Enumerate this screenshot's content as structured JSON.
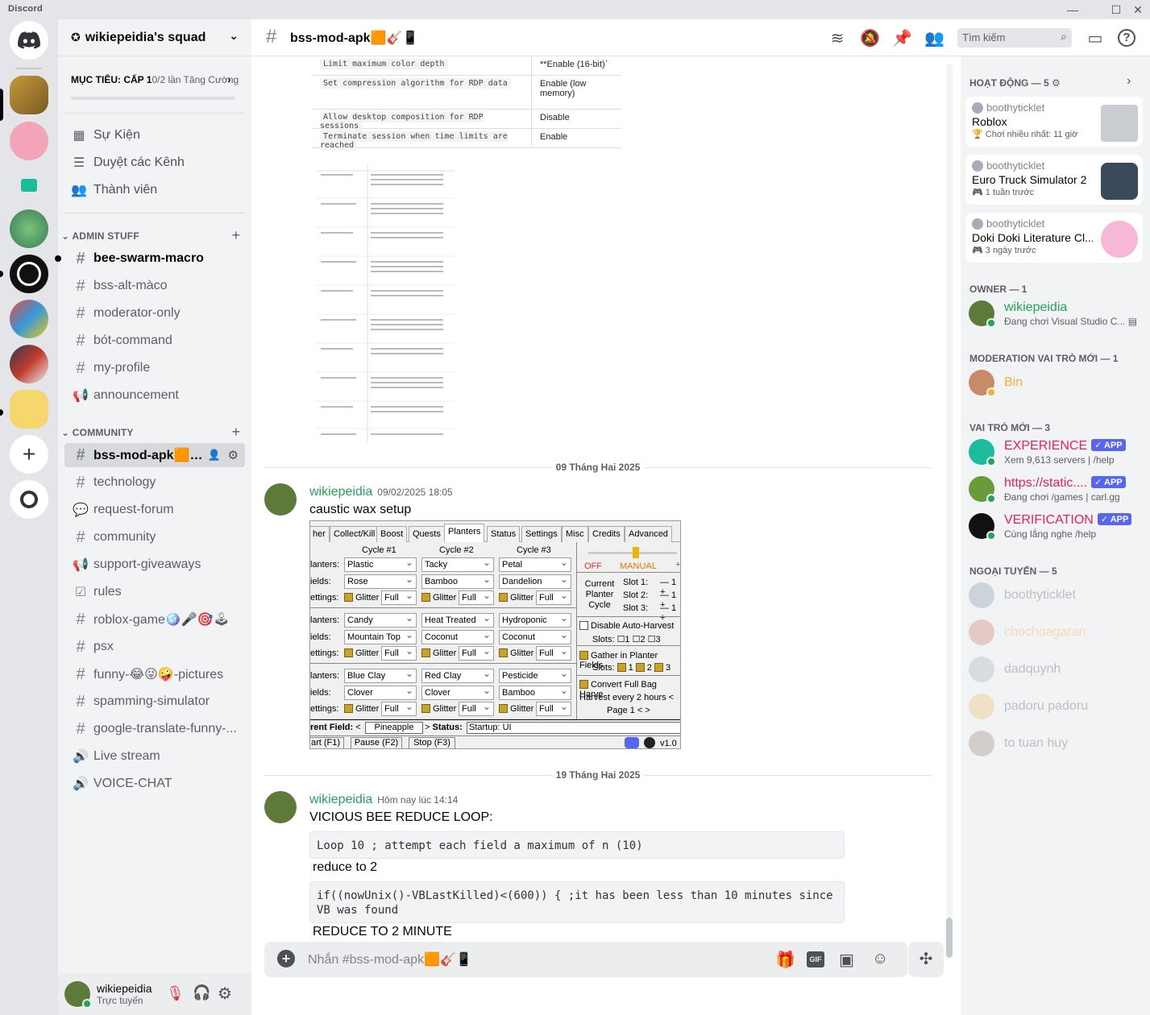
{
  "app": {
    "title": "Discord"
  },
  "server": {
    "name": "wikiepeidia's squad",
    "goal_prefix": "MỤC TIÊU: CẤP 1",
    "goal_suffix": "0/2 lần Tăng Cường",
    "nav": [
      {
        "label": "Sự Kiện",
        "icon": "calendar-icon"
      },
      {
        "label": "Duyệt các Kênh",
        "icon": "browse-channels-icon"
      },
      {
        "label": "Thành viên",
        "icon": "members-icon"
      }
    ],
    "categories": [
      {
        "name": "ADMIN STUFF",
        "channels": [
          {
            "name": "bee-swarm-macro",
            "type": "text",
            "unread": true
          },
          {
            "name": "bss-alt-màco",
            "type": "text"
          },
          {
            "name": "moderator-only",
            "type": "text"
          },
          {
            "name": "bót-command",
            "type": "text"
          },
          {
            "name": "my-profile",
            "type": "text"
          },
          {
            "name": "announcement",
            "type": "announcement"
          }
        ]
      },
      {
        "name": "COMMUNITY",
        "channels": [
          {
            "name": "bss-mod-apk🟧…",
            "type": "text",
            "selected": true
          },
          {
            "name": "technology",
            "type": "text"
          },
          {
            "name": "request-forum",
            "type": "forum"
          },
          {
            "name": "community",
            "type": "text"
          },
          {
            "name": "support-giveaways",
            "type": "announcement"
          },
          {
            "name": "rules",
            "type": "rules"
          },
          {
            "name": "roblox-game🪩🎤🎯🕹",
            "type": "text"
          },
          {
            "name": "psx",
            "type": "text"
          },
          {
            "name": "funny-😂😜🤪-pictures",
            "type": "text"
          },
          {
            "name": "spamming-simulator",
            "type": "text"
          },
          {
            "name": "google-translate-funny-...",
            "type": "text"
          },
          {
            "name": "Live stream",
            "type": "voice"
          },
          {
            "name": "VOICE-CHAT",
            "type": "voice"
          }
        ]
      }
    ]
  },
  "user": {
    "name": "wikiepeidia",
    "status": "Trực tuyến"
  },
  "channel": {
    "name": "bss-mod-apk🟧🎸📱",
    "search_placeholder": "Tìm kiếm",
    "composer_placeholder": "Nhắn #bss-mod-apk🟧🎸📱"
  },
  "rdp_table": [
    {
      "key": "Limit maximum color depth",
      "value": "**Enable (16-bit)`"
    },
    {
      "key": "Set compression algorithm for RDP data",
      "value": "Enable (low memory)"
    },
    {
      "key": "Allow desktop composition for RDP sessions",
      "value": "Disable"
    },
    {
      "key": "Terminate session when time limits are reached",
      "value": "Enable"
    }
  ],
  "dividers": [
    "09 Tháng Hai 2025",
    "19 Tháng Hai 2025"
  ],
  "messages": [
    {
      "author": "wikiepeidia",
      "time": "09/02/2025 18:05",
      "text": "caustic wax setup"
    },
    {
      "author": "wikiepeidia",
      "time": "Hôm nay lúc 14:14",
      "text": "VICIOUS BEE REDUCE LOOP:",
      "code1": "Loop 10 ; attempt each field a maximum of n (10)",
      "text2": "reduce to 2",
      "code2": "if((nowUnix()-VBLastKilled)<(600)) { ;it has been less than 10 minutes since VB was found",
      "text3": "REDUCE TO 2 MINUTE"
    }
  ],
  "macro": {
    "tabs": [
      "her",
      "Collect/Kill",
      "Boost",
      "Quests",
      "Planters",
      "Status",
      "Settings",
      "Misc",
      "Credits",
      "Advanced"
    ],
    "cycles": [
      "Cycle #1",
      "Cycle #2",
      "Cycle #3"
    ],
    "row_labels": [
      "lanters:",
      "ields:",
      "ettings:"
    ],
    "blocks": [
      {
        "planters": [
          "Plastic",
          "Tacky",
          "Petal"
        ],
        "fields": [
          "Rose",
          "Bamboo",
          "Dandelion"
        ]
      },
      {
        "planters": [
          "Candy",
          "Heat Treated",
          "Hydroponic"
        ],
        "fields": [
          "Mountain Top",
          "Coconut",
          "Coconut"
        ]
      },
      {
        "planters": [
          "Blue Clay",
          "Red Clay",
          "Pesticide"
        ],
        "fields": [
          "Clover",
          "Clover",
          "Bamboo"
        ]
      }
    ],
    "glitter": "Glitter",
    "full": "Full",
    "off": "OFF",
    "manual": "MANUAL",
    "current_planter_cycle": "Current Planter Cycle",
    "slots": [
      "Slot 1:",
      "Slot 2:",
      "Slot 3:"
    ],
    "disable_auto_harvest": "Disable Auto-Harvest",
    "slots_label": "Slots:",
    "gather_in_planter_fields": "Gather in Planter Fields",
    "convert_full_bag": "Convert Full Bag Harve",
    "harvest_every": "Harvest every 2 hours",
    "page": "Page 1",
    "current_field": "rent Field:",
    "field_value": "Pineapple",
    "status_label": "Status:",
    "status_value": "Startup: UI",
    "buttons": [
      "art (F1)",
      "Pause (F2)",
      "Stop (F3)"
    ],
    "version": "v1.0"
  },
  "members": {
    "activity_header": "HOẠT ĐỘNG — 5",
    "activities": [
      {
        "user": "boothyticklet",
        "game": "Roblox",
        "time": "Chơi nhiều nhất: 11 giờ",
        "color": "#c9ccd1"
      },
      {
        "user": "boothyticklet",
        "game": "Euro Truck Simulator 2",
        "time": "1 tuần trước",
        "color": "#3b4a5a"
      },
      {
        "user": "boothyticklet",
        "game": "Doki Doki Literature Cl...",
        "time": "3 ngày trước",
        "color": "#f7b8d8"
      }
    ],
    "owner_header": "OWNER — 1",
    "owner": {
      "name": "wikiepeidia",
      "status": "Đang chơi Visual Studio C..."
    },
    "mod_header": "MODERATION VAI TRÒ MỚI — 1",
    "mod": {
      "name": "Bin"
    },
    "roles_header": "VAI TRÒ MỚI — 3",
    "bots": [
      {
        "name": "EXPERIENCE",
        "status": "Xem 9,613 servers | /help",
        "badge": "APP"
      },
      {
        "name": "https://static....",
        "status": "Đang chơi /games | carl.gg",
        "badge": "APP"
      },
      {
        "name": "VERIFICATION",
        "status": "Cùng lắng nghe /help",
        "badge": "APP"
      }
    ],
    "offline_header": "NGOẠI TUYẾN — 5",
    "offline": [
      "boothyticklet",
      "chochoagaran",
      "dadquynh",
      "padoru padoru",
      "to tuan huy"
    ]
  }
}
